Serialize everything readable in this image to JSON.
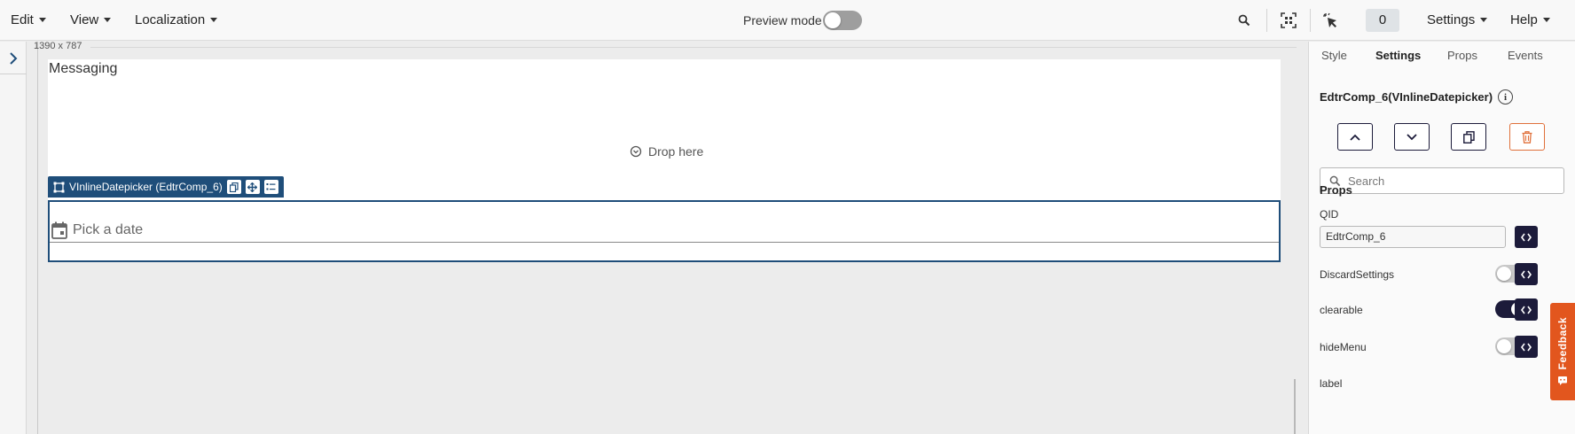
{
  "menus": {
    "edit": "Edit",
    "view": "View",
    "localization": "Localization",
    "settings": "Settings",
    "help": "Help"
  },
  "toolbar": {
    "preview_label": "Preview mode",
    "preview_on": false,
    "counter": "0"
  },
  "canvas": {
    "size_label": "1390 x 787",
    "messaging_text": "Messaging",
    "drop_text": "Drop here",
    "component_tag": "VInlineDatepicker (EdtrComp_6)",
    "date_placeholder": "Pick a date"
  },
  "panel": {
    "tabs": [
      "Style",
      "Settings",
      "Props",
      "Events"
    ],
    "active_tab": "Settings",
    "component_title": "EdtrComp_6(VInlineDatepicker)",
    "info_glyph": "i",
    "search_placeholder": "Search",
    "props_title": "Props",
    "qid_label": "QID",
    "qid_value": "EdtrComp_6",
    "props": [
      {
        "label": "DiscardSettings",
        "on": false
      },
      {
        "label": "clearable",
        "on": true
      },
      {
        "label": "hideMenu",
        "on": false
      }
    ],
    "next_label": "label"
  },
  "feedback_label": "Feedback",
  "colors": {
    "accent_dark": "#1c1b3a",
    "component_blue": "#1f4e7a",
    "danger": "#e0703a",
    "feedback": "#e2561e"
  }
}
